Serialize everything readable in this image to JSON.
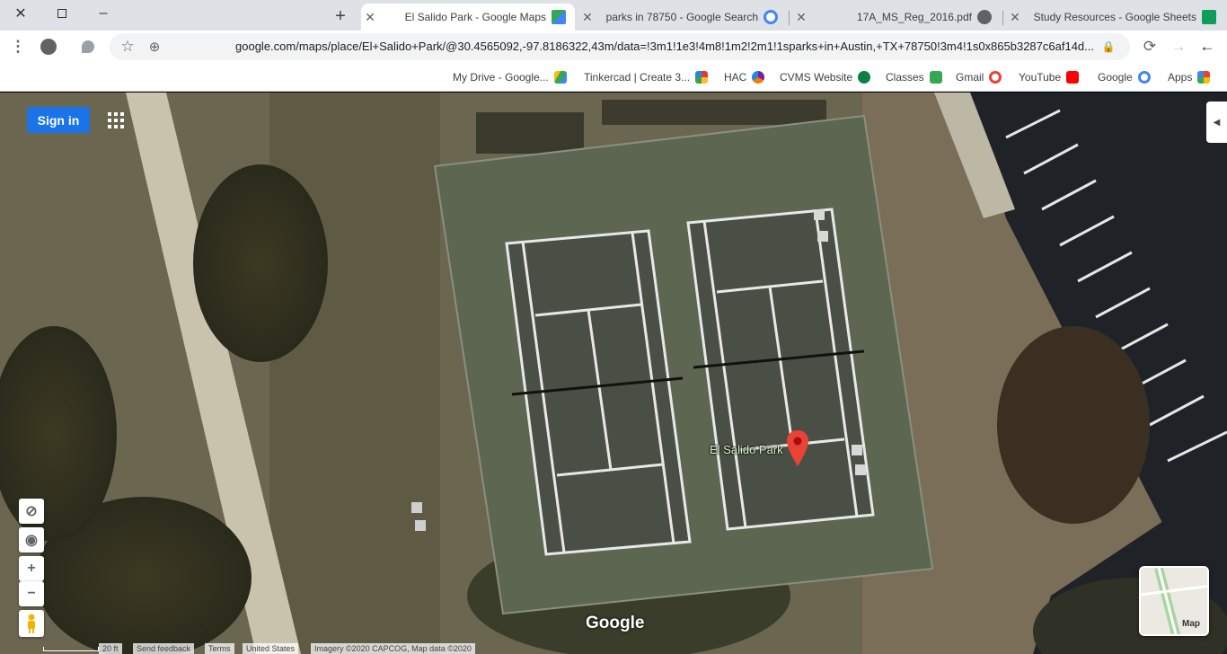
{
  "tabs": [
    {
      "title": "Study Resources - Google Sheets",
      "favicon_color": "#0f9d58"
    },
    {
      "title": "17A_MS_Reg_2016.pdf",
      "favicon_color": "#5f6368"
    },
    {
      "title": "parks in 78750 - Google Search",
      "favicon_color": "#4285f4"
    },
    {
      "title": "El Salido Park - Google Maps",
      "favicon_color": "#34a853"
    }
  ],
  "toolbar": {
    "url": "google.com/maps/place/El+Salido+Park/@30.4565092,-97.8186322,43m/data=!3m1!1e3!4m8!1m2!2m1!1sparks+in+Austin,+TX+78750!3m4!1s0x865b3287c6af14d..."
  },
  "bookmarks": [
    {
      "label": "Apps",
      "color": "#ea4335"
    },
    {
      "label": "Google",
      "color": "#4285f4"
    },
    {
      "label": "YouTube",
      "color": "#ff0000"
    },
    {
      "label": "Gmail",
      "color": "#ea4335"
    },
    {
      "label": "Classes",
      "color": "#34a853"
    },
    {
      "label": "CVMS Website",
      "color": "#0b8043"
    },
    {
      "label": "HAC",
      "color": "#7b1fa2"
    },
    {
      "label": "Tinkercad | Create 3...",
      "color": "#e53935"
    },
    {
      "label": "My Drive - Google...",
      "color": "#fbbc04"
    }
  ],
  "map": {
    "sign_in_label": "Sign in",
    "place_label": "El Salido Park",
    "logo_text": "Google",
    "layer_label": "Map",
    "footer": {
      "imagery": "Imagery ©2020 CAPCOG, Map data ©2020",
      "country": "United States",
      "terms": "Terms",
      "feedback": "Send feedback",
      "scale": "20 ft"
    }
  }
}
